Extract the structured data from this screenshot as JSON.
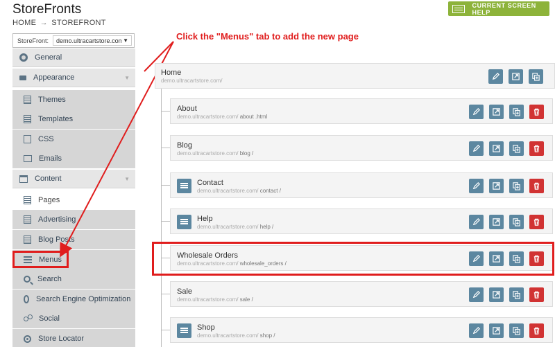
{
  "app": {
    "title": "StoreFronts",
    "breadcrumb": [
      "HOME",
      "STOREFRONT"
    ],
    "breadcrumb_sep": "→",
    "help_button": "CURRENT SCREEN HELP"
  },
  "storefront_select": {
    "label": "StoreFront:",
    "value": "demo.ultracartstore.com",
    "caret": "▼"
  },
  "sidebar": {
    "items": [
      {
        "label": "General",
        "icon": "gear-icon",
        "level": "top"
      },
      {
        "label": "Appearance",
        "icon": "paintbrush-icon",
        "level": "top",
        "expandable": true
      },
      {
        "label": "Themes",
        "icon": "themes-icon",
        "level": "sub"
      },
      {
        "label": "Templates",
        "icon": "templates-icon",
        "level": "sub"
      },
      {
        "label": "CSS",
        "icon": "css-icon",
        "level": "sub"
      },
      {
        "label": "Emails",
        "icon": "email-icon",
        "level": "sub"
      },
      {
        "label": "Content",
        "icon": "content-icon",
        "level": "top",
        "expandable": true
      },
      {
        "label": "Pages",
        "icon": "pages-icon",
        "level": "sub",
        "active": true
      },
      {
        "label": "Advertising",
        "icon": "advertising-icon",
        "level": "sub"
      },
      {
        "label": "Blog Posts",
        "icon": "blog-posts-icon",
        "level": "sub"
      },
      {
        "label": "Menus",
        "icon": "menu-icon",
        "level": "sub",
        "highlighted": true
      },
      {
        "label": "Search",
        "icon": "search-icon",
        "level": "sub"
      },
      {
        "label": "Search Engine Optimization",
        "icon": "seo-icon",
        "level": "sub"
      },
      {
        "label": "Social",
        "icon": "social-icon",
        "level": "sub"
      },
      {
        "label": "Store Locator",
        "icon": "store-locator-icon",
        "level": "sub"
      }
    ]
  },
  "annotation": {
    "text": "Click the \"Menus\" tab to add the new page",
    "color": "#e01d1d"
  },
  "pages": {
    "root": {
      "title": "Home",
      "domain": "demo.ultracartstore.com/",
      "slug": ""
    },
    "children": [
      {
        "title": "About",
        "domain": "demo.ultracartstore.com/",
        "slug": " about .html",
        "menu_icon": false
      },
      {
        "title": "Blog",
        "domain": "demo.ultracartstore.com/",
        "slug": " blog /",
        "menu_icon": false
      },
      {
        "title": "Contact",
        "domain": "demo.ultracartstore.com/",
        "slug": " contact /",
        "menu_icon": true
      },
      {
        "title": "Help",
        "domain": "demo.ultracartstore.com/",
        "slug": " help /",
        "menu_icon": true
      },
      {
        "title": "Wholesale Orders",
        "domain": "demo.ultracartstore.com/",
        "slug": " wholesale_orders /",
        "menu_icon": false,
        "highlighted": true
      },
      {
        "title": "Sale",
        "domain": "demo.ultracartstore.com/",
        "slug": " sale /",
        "menu_icon": false
      },
      {
        "title": "Shop",
        "domain": "demo.ultracartstore.com/",
        "slug": " shop /",
        "menu_icon": true
      }
    ]
  },
  "colors": {
    "action_blue": "#5c87a0",
    "delete_red": "#d13333",
    "help_green": "#8db33a",
    "highlight_red": "#e01d1d"
  }
}
